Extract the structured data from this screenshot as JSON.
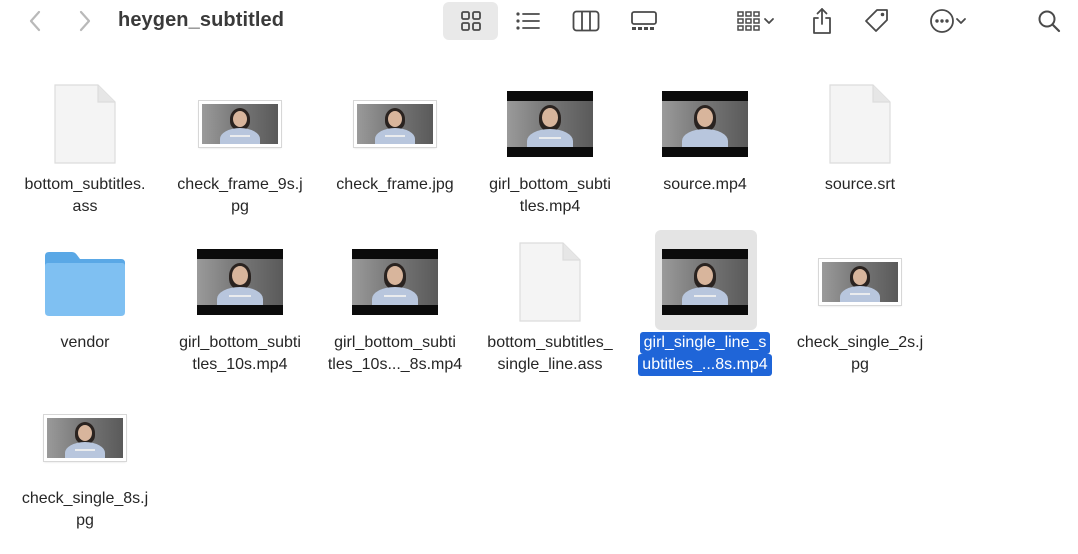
{
  "window": {
    "title": "heygen_subtitled"
  },
  "toolbar": {
    "back": "chevron-left-icon",
    "forward": "chevron-right-icon",
    "views": [
      "icon-view",
      "list-view",
      "column-view",
      "gallery-view"
    ],
    "active_view": "icon-view"
  },
  "files": [
    {
      "line1": "bottom_subtitles.",
      "line2": "ass",
      "kind": "document"
    },
    {
      "line1": "check_frame_9s.j",
      "line2": "pg",
      "kind": "image"
    },
    {
      "line1": "check_frame.jpg",
      "line2": "",
      "kind": "image"
    },
    {
      "line1": "girl_bottom_subti",
      "line2": "tles.mp4",
      "kind": "video"
    },
    {
      "line1": "source.mp4",
      "line2": "",
      "kind": "video"
    },
    {
      "line1": "source.srt",
      "line2": "",
      "kind": "document"
    },
    {
      "line1": "vendor",
      "line2": "",
      "kind": "folder"
    },
    {
      "line1": "girl_bottom_subti",
      "line2": "tles_10s.mp4",
      "kind": "video"
    },
    {
      "line1": "girl_bottom_subti",
      "line2": "tles_10s..._8s.mp4",
      "kind": "video"
    },
    {
      "line1": "bottom_subtitles_",
      "line2": "single_line.ass",
      "kind": "document"
    },
    {
      "line1": "girl_single_line_s",
      "line2": "ubtitles_...8s.mp4",
      "kind": "video",
      "selected": true
    },
    {
      "line1": "check_single_2s.j",
      "line2": "pg",
      "kind": "image"
    },
    {
      "line1": "check_single_8s.j",
      "line2": "pg",
      "kind": "image"
    }
  ]
}
